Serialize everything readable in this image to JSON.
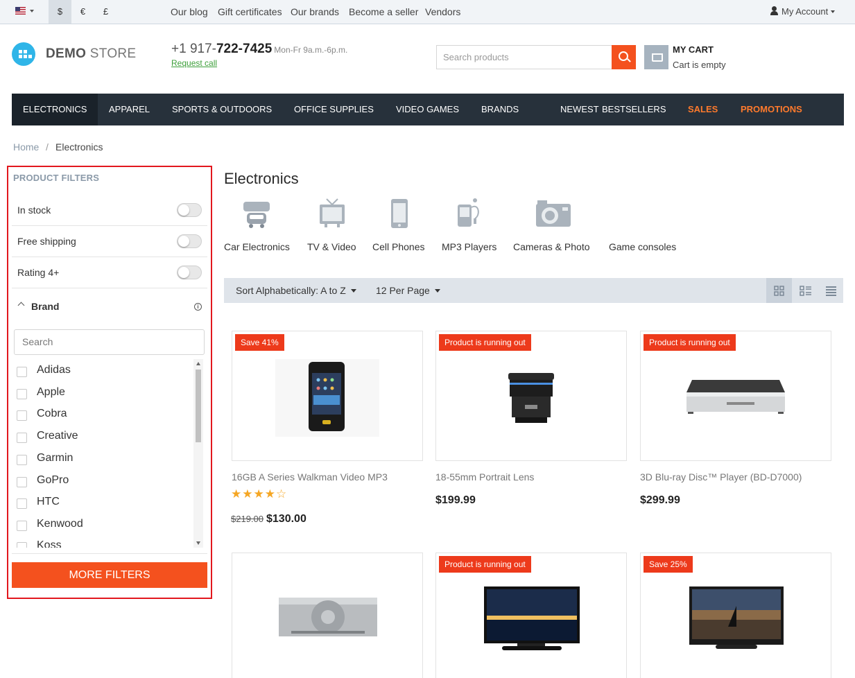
{
  "topbar": {
    "currencies": [
      "$",
      "€",
      "£"
    ],
    "links": [
      "Our blog",
      "Gift certificates",
      "Our brands",
      "Become a seller",
      "Vendors"
    ],
    "account": "My Account"
  },
  "header": {
    "logo_bold": "DEMO",
    "logo_light": " STORE",
    "phone_prefix": "+1 917-",
    "phone_main": "722-7425",
    "hours": "Mon-Fr 9a.m.-6p.m.",
    "request_call": "Request call",
    "search_placeholder": "Search products",
    "cart_title": "MY CART",
    "cart_status": "Cart is empty"
  },
  "menu": [
    "ELECTRONICS",
    "APPAREL",
    "SPORTS & OUTDOORS",
    "OFFICE SUPPLIES",
    "VIDEO GAMES",
    "BRANDS",
    "NEWEST",
    "BESTSELLERS",
    "SALES",
    "PROMOTIONS"
  ],
  "breadcrumb": {
    "home": "Home",
    "separator": "/",
    "current": "Electronics"
  },
  "filters": {
    "title": "PRODUCT FILTERS",
    "toggles": [
      "In stock",
      "Free shipping",
      "Rating 4+"
    ],
    "brand_label": "Brand",
    "brand_search_placeholder": "Search",
    "brands": [
      "Adidas",
      "Apple",
      "Cobra",
      "Creative",
      "Garmin",
      "GoPro",
      "HTC",
      "Kenwood",
      "Koss"
    ],
    "more_button": "MORE FILTERS"
  },
  "content": {
    "title": "Electronics",
    "categories": [
      "Car Electronics",
      "TV & Video",
      "Cell Phones",
      "MP3 Players",
      "Cameras & Photo",
      "Game consoles"
    ],
    "sort": "Sort Alphabetically: A to Z",
    "per_page": "12 Per Page"
  },
  "products": [
    {
      "badge": "Save 41%",
      "name": "16GB A Series Walkman Video MP3",
      "rating": 4.5,
      "old_price": "$219.00",
      "price": "$130.00"
    },
    {
      "badge": "Product is running out",
      "name": "18-55mm Portrait Lens",
      "price": "$199.99"
    },
    {
      "badge": "Product is running out",
      "name": "3D Blu-ray Disc™ Player (BD-D7000)",
      "price": "$299.99"
    },
    {
      "badge": "",
      "name": "",
      "price": ""
    },
    {
      "badge": "Product is running out",
      "name": "",
      "price": ""
    },
    {
      "badge": "Save 25%",
      "name": "",
      "price": ""
    }
  ]
}
